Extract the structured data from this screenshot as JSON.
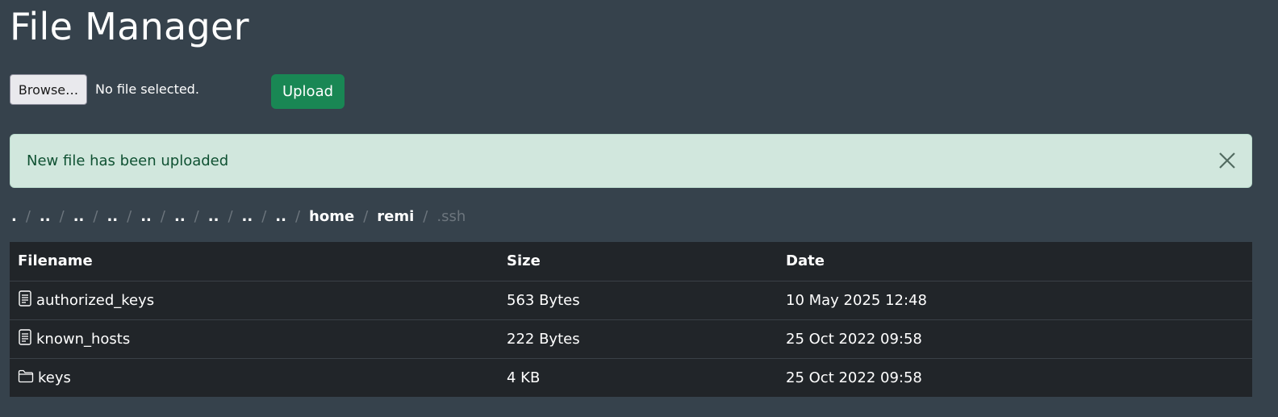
{
  "page": {
    "title": "File Manager"
  },
  "upload": {
    "browse_label": "Browse…",
    "file_status": "No file selected.",
    "upload_label": "Upload"
  },
  "alert": {
    "message": "New file has been uploaded",
    "close_icon": "close-icon"
  },
  "breadcrumb": {
    "items": [
      ".",
      "..",
      "..",
      "..",
      "..",
      "..",
      "..",
      "..",
      "..",
      "home",
      "remi",
      ".ssh"
    ],
    "separator": "/"
  },
  "table": {
    "headers": {
      "name": "Filename",
      "size": "Size",
      "date": "Date"
    },
    "rows": [
      {
        "icon": "file-icon",
        "name": "authorized_keys",
        "size": "563 Bytes",
        "date": "10 May 2025 12:48"
      },
      {
        "icon": "file-icon",
        "name": "known_hosts",
        "size": "222 Bytes",
        "date": "25 Oct 2022 09:58"
      },
      {
        "icon": "folder-icon",
        "name": "keys",
        "size": "4 KB",
        "date": "25 Oct 2022 09:58"
      }
    ]
  },
  "colors": {
    "background": "#36424c",
    "upload_button": "#198754",
    "alert_background": "#d1e7dd",
    "alert_text": "#0f5132",
    "table_background": "#212529"
  }
}
